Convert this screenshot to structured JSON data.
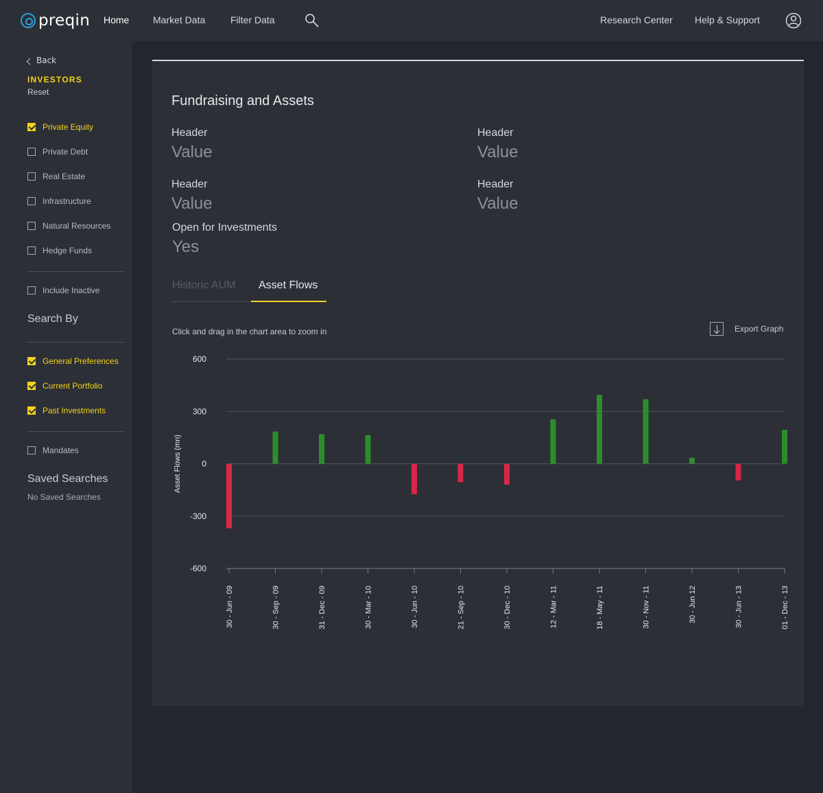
{
  "topbar": {
    "logo": "preqin",
    "nav": {
      "home": "Home",
      "market_data": "Market Data",
      "filter_data": "Filter Data"
    },
    "right": {
      "research_center": "Research Center",
      "help_support": "Help & Support"
    },
    "icons": {
      "search": "search-icon",
      "user": "user-icon"
    }
  },
  "sidebar": {
    "back": "Back",
    "section": "INVESTORS",
    "reset": "Reset",
    "asset_classes": [
      {
        "label": "Private Equity",
        "checked": true
      },
      {
        "label": "Private Debt",
        "checked": false
      },
      {
        "label": "Real Estate",
        "checked": false
      },
      {
        "label": "Infrastructure",
        "checked": false
      },
      {
        "label": "Natural Resources",
        "checked": false
      },
      {
        "label": "Hedge Funds",
        "checked": false
      }
    ],
    "include_inactive": {
      "label": "Include Inactive",
      "checked": false
    },
    "search_by": "Search By",
    "search_options": [
      {
        "label": "General Preferences",
        "checked": true
      },
      {
        "label": "Current Portfolio",
        "checked": true
      },
      {
        "label": "Past Investments",
        "checked": true
      }
    ],
    "mandates": {
      "label": "Mandates",
      "checked": false
    },
    "saved_searches": "Saved Searches",
    "no_saved": "No Saved Searches"
  },
  "panel": {
    "title": "Fundraising and Assets",
    "fields": [
      {
        "header": "Header",
        "value": "Value"
      },
      {
        "header": "Header",
        "value": "Value"
      },
      {
        "header": "Header",
        "value": "Value"
      },
      {
        "header": "Header",
        "value": "Value"
      }
    ],
    "open_for_investments": {
      "header": "Open for Investments",
      "value": "Yes"
    },
    "tabs": {
      "historic": "Historic AUM",
      "asset_flows": "Asset Flows"
    },
    "hint": "Click and drag in the chart area to zoom in",
    "export": "Export Graph"
  },
  "chart_data": {
    "type": "bar",
    "ylabel": "Asset Flows (mn)",
    "ylim": [
      -600,
      600
    ],
    "yticks": [
      600,
      300,
      0,
      -300,
      -600
    ],
    "grid": true,
    "colors": {
      "positive": "#2b8e2b",
      "negative": "#d8264a"
    },
    "categories": [
      "30 - Jun - 09",
      "30 - Sep - 09",
      "31 - Dec - 09",
      "30 - Mar - 10",
      "30 - Jun - 10",
      "21 - Sep - 10",
      "30 - Dec - 10",
      "12 - Mar - 11",
      "18 - May - 11",
      "30 - Nov - 11",
      "30 - Jun 12",
      "30 - Jun - 13",
      "01 - Dec - 13"
    ],
    "values": [
      -370,
      185,
      170,
      165,
      -175,
      -105,
      -120,
      255,
      395,
      370,
      35,
      -95,
      195
    ]
  }
}
